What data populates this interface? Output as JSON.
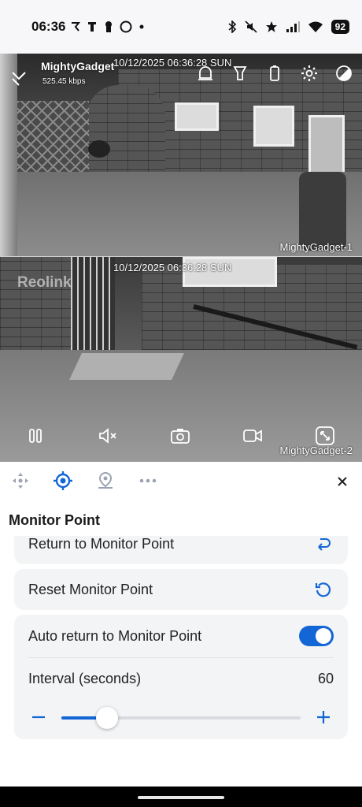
{
  "status_bar": {
    "time": "06:36",
    "battery": "92",
    "icons_left": [
      "notification-icon",
      "sim-icon",
      "keyhole-icon",
      "circle-icon",
      "dot-icon"
    ],
    "icons_right": [
      "bluetooth-icon",
      "mute-icon",
      "star-icon",
      "signal-icon",
      "wifi-icon"
    ]
  },
  "camera1": {
    "title": "MightyGadget",
    "bitrate": "525.45 kbps",
    "timestamp": "10/12/2025 06:36:28 SUN",
    "name": "MightyGadget-1"
  },
  "camera2": {
    "timestamp": "10/12/2025 06:36:28 SUN",
    "name": "MightyGadget-2",
    "watermark": "Reolink"
  },
  "top_controls": [
    "alarm-icon",
    "spotlight-icon",
    "battery-status-icon",
    "settings-icon",
    "contrast-icon"
  ],
  "bottom_controls": [
    "pause-icon",
    "mute-icon",
    "snapshot-icon",
    "record-icon",
    "fullscreen-icon"
  ],
  "ptz": {
    "tabs": [
      "ptz-directions-icon",
      "monitor-point-icon",
      "preset-location-icon",
      "more-icon"
    ],
    "active_tab": 1,
    "section_title": "Monitor Point",
    "rows": {
      "return": "Return to Monitor Point",
      "reset": "Reset Monitor Point",
      "auto_return": "Auto return to Monitor Point",
      "interval_label": "Interval (seconds)",
      "interval_value": "60"
    },
    "auto_return_enabled": true,
    "slider_fraction": 0.19
  },
  "colors": {
    "accent": "#1366d6",
    "card_bg": "#f3f4f6"
  }
}
